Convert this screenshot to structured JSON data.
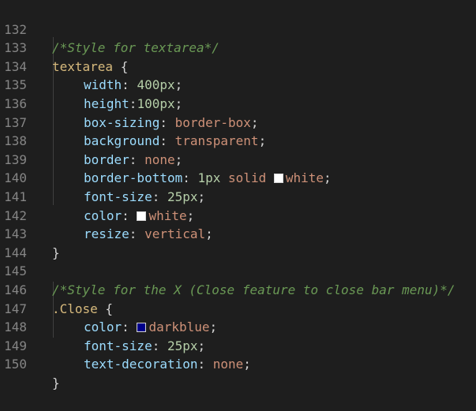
{
  "editor": {
    "colors": {
      "background": "#1e1e1e",
      "comment": "#6a9955",
      "selector": "#d7ba7d",
      "property": "#9cdcfe",
      "value": "#ce9178",
      "number": "#b5cea8",
      "white_swatch": "#ffffff",
      "darkblue_swatch": "#00008b"
    },
    "lines": {
      "l132": {
        "num": "132",
        "comment": "/*Style for textarea*/"
      },
      "l133": {
        "num": "133",
        "selector": "textarea",
        "brace": " {"
      },
      "l134": {
        "num": "134",
        "prop": "width",
        "num_val": "400px"
      },
      "l135": {
        "num": "135",
        "prop": "height",
        "num_val": "100px"
      },
      "l136": {
        "num": "136",
        "prop": "box-sizing",
        "value": "border-box"
      },
      "l137": {
        "num": "137",
        "prop": "background",
        "value": "transparent"
      },
      "l138": {
        "num": "138",
        "prop": "border",
        "value": "none"
      },
      "l139": {
        "num": "139",
        "prop": "border-bottom",
        "num_val": "1px",
        "value": "solid",
        "color_val": "white"
      },
      "l140": {
        "num": "140",
        "prop": "font-size",
        "num_val": "25px"
      },
      "l141": {
        "num": "141",
        "prop": "color",
        "color_val": "white"
      },
      "l142": {
        "num": "142",
        "prop": "resize",
        "value": "vertical"
      },
      "l143": {
        "num": "143",
        "brace": "}"
      },
      "l144": {
        "num": "144"
      },
      "l145": {
        "num": "145",
        "comment": "/*Style for the X (Close feature to close bar menu)*/"
      },
      "l146": {
        "num": "146",
        "selector": ".Close",
        "brace": " {"
      },
      "l147": {
        "num": "147",
        "prop": "color",
        "color_val": "darkblue"
      },
      "l148": {
        "num": "148",
        "prop": "font-size",
        "num_val": "25px"
      },
      "l149": {
        "num": "149",
        "prop": "text-decoration",
        "value": "none"
      },
      "l150": {
        "num": "150",
        "brace": "}"
      }
    }
  }
}
